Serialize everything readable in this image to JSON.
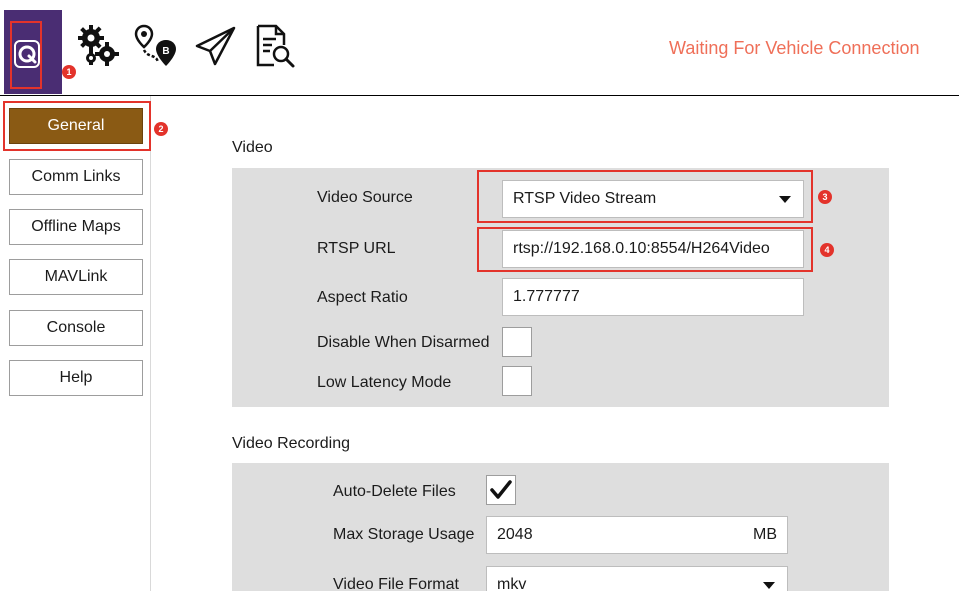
{
  "toolbar": {
    "status": "Waiting For Vehicle Connection",
    "icons": [
      "app-logo-icon",
      "gears-icon",
      "plan-waypoint-icon",
      "fly-paper-plane-icon",
      "analyze-document-icon"
    ],
    "callouts": [
      "1",
      "2",
      "3",
      "4"
    ]
  },
  "sidebar": {
    "items": [
      {
        "label": "General",
        "active": true
      },
      {
        "label": "Comm Links"
      },
      {
        "label": "Offline Maps"
      },
      {
        "label": "MAVLink"
      },
      {
        "label": "Console"
      },
      {
        "label": "Help"
      }
    ]
  },
  "video": {
    "title": "Video",
    "source_label": "Video Source",
    "source_value": "RTSP Video Stream",
    "url_label": "RTSP URL",
    "url_value": "rtsp://192.168.0.10:8554/H264Video",
    "aspect_label": "Aspect Ratio",
    "aspect_value": "1.777777",
    "disable_label": "Disable When Disarmed",
    "disable_checked": false,
    "lowlat_label": "Low Latency Mode",
    "lowlat_checked": false
  },
  "recording": {
    "title": "Video Recording",
    "autodelete_label": "Auto-Delete Files",
    "autodelete_checked": true,
    "maxstorage_label": "Max Storage Usage",
    "maxstorage_value": "2048",
    "maxstorage_unit": "MB",
    "format_label": "Video File Format",
    "format_value": "mkv"
  },
  "colors": {
    "accent": "#8a5a14",
    "toolbar_app": "#4a2d73",
    "status": "#ef6f58",
    "callout": "#e3332b",
    "panel": "#dedede"
  }
}
